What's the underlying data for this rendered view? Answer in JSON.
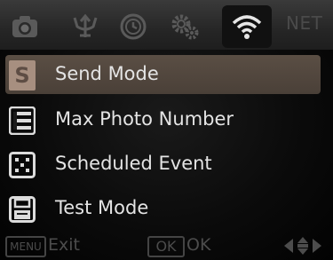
{
  "tabs": {
    "items": [
      {
        "icon": "camera-icon"
      },
      {
        "icon": "trident-icon"
      },
      {
        "icon": "clock-icon"
      },
      {
        "icon": "gears-icon"
      },
      {
        "icon": "wifi-icon",
        "active": true
      }
    ],
    "net_label": "NET"
  },
  "menu": {
    "items": [
      {
        "label": "Send Mode",
        "icon": "s-badge-icon",
        "badge": "S",
        "selected": true
      },
      {
        "label": "Max Photo Number",
        "icon": "numbered-list-icon"
      },
      {
        "label": "Scheduled Event",
        "icon": "scheduled-event-icon"
      },
      {
        "label": "Test Mode",
        "icon": "floppy-disk-icon"
      }
    ]
  },
  "footer": {
    "menu_key": "MENU",
    "exit_label": "Exit",
    "ok_key": "OK",
    "ok_label": "OK",
    "nav_icon": "left-right-arrows-icon"
  },
  "colors": {
    "selection": "#54493f",
    "badge": "#a78f80",
    "text": "#e4e4e4",
    "dim_text": "#4c4c4c",
    "tabbar": "#2c2c2c"
  }
}
